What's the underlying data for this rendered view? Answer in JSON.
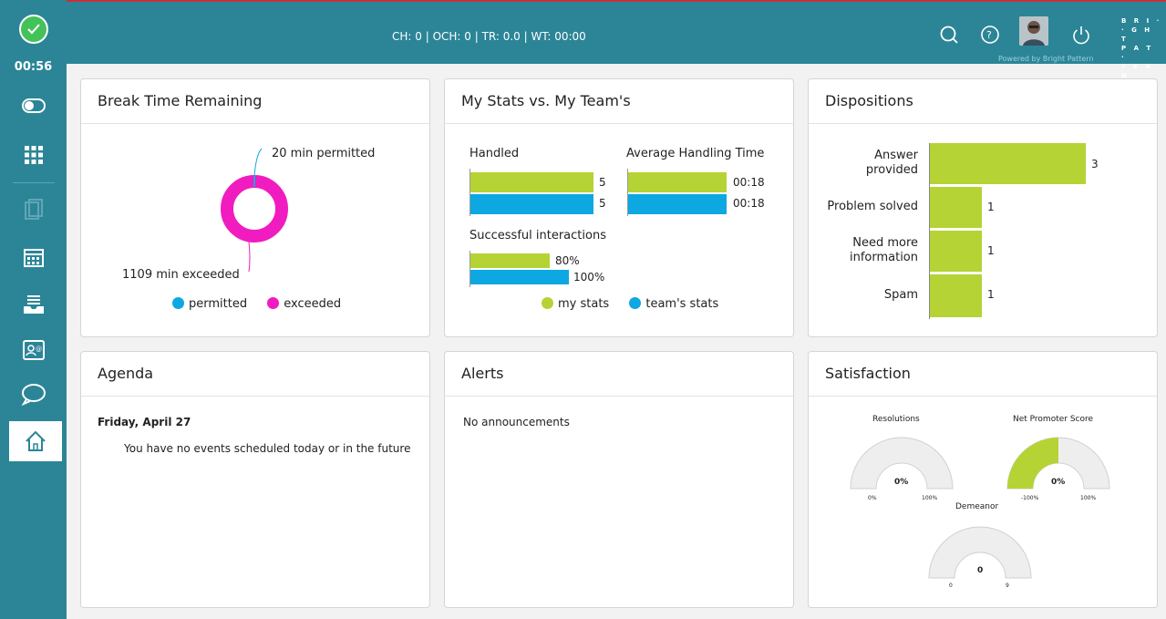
{
  "sidebar": {
    "timer": "00:56",
    "items": [
      {
        "name": "status-toggle-icon"
      },
      {
        "name": "dialpad-icon"
      },
      {
        "name": "document-icon"
      },
      {
        "name": "calendar-icon"
      },
      {
        "name": "inbox-tray-icon"
      },
      {
        "name": "contact-card-icon"
      },
      {
        "name": "chat-icon"
      },
      {
        "name": "home-icon"
      }
    ]
  },
  "topbar": {
    "stats": "CH: 0 | OCH: 0 | TR: 0.0 | WT: 00:00",
    "powered_by": "Powered by Bright Pattern",
    "brand_lines": [
      "B R I ·",
      "· G H T",
      "P A T ·",
      "T E R N"
    ]
  },
  "break_time": {
    "title": "Break Time Remaining",
    "permitted_label": "20 min permitted",
    "exceeded_label": "1109 min exceeded",
    "legend": [
      "permitted",
      "exceeded"
    ],
    "colors": {
      "permitted": "#0da8e2",
      "exceeded": "#f01cbf"
    },
    "chart_data": {
      "type": "pie",
      "labels": [
        "permitted",
        "exceeded"
      ],
      "values": [
        20,
        1109
      ]
    }
  },
  "my_stats": {
    "title": "My Stats vs. My Team's",
    "handled_label": "Handled",
    "handled_my": "5",
    "handled_team": "5",
    "aht_label": "Average Handling Time",
    "aht_my": "00:18",
    "aht_team": "00:18",
    "success_label": "Successful interactions",
    "success_my": "80%",
    "success_team": "100%",
    "legend": [
      "my stats",
      "team's stats"
    ],
    "chart_data": {
      "type": "bar",
      "groups": [
        {
          "name": "Handled",
          "my": 5,
          "team": 5
        },
        {
          "name": "Average Handling Time",
          "my": "00:18",
          "team": "00:18"
        },
        {
          "name": "Successful interactions",
          "my": 80,
          "team": 100
        }
      ]
    }
  },
  "dispositions": {
    "title": "Dispositions",
    "rows": [
      {
        "label_lines": [
          "Answer",
          "provided"
        ],
        "value": "3"
      },
      {
        "label_lines": [
          "Problem solved"
        ],
        "value": "1"
      },
      {
        "label_lines": [
          "Need more",
          "information"
        ],
        "value": "1"
      },
      {
        "label_lines": [
          "Spam"
        ],
        "value": "1"
      }
    ],
    "chart_data": {
      "type": "bar",
      "categories": [
        "Answer provided",
        "Problem solved",
        "Need more information",
        "Spam"
      ],
      "values": [
        3,
        1,
        1,
        1
      ],
      "max": 3
    }
  },
  "agenda": {
    "title": "Agenda",
    "date": "Friday, April 27",
    "message": "You have no events scheduled today or in the future"
  },
  "alerts": {
    "title": "Alerts",
    "message": "No announcements"
  },
  "satisfaction": {
    "title": "Satisfaction",
    "gauges": [
      {
        "label": "Resolutions",
        "value": "0%",
        "min": "0%",
        "max": "100%",
        "fill": 0
      },
      {
        "label": "Net Promoter Score",
        "value": "0%",
        "min": "-100%",
        "max": "100%",
        "fill": 0.5
      },
      {
        "label": "Demeanor",
        "value": "0",
        "min": "0",
        "max": "9",
        "fill": 0
      }
    ]
  }
}
